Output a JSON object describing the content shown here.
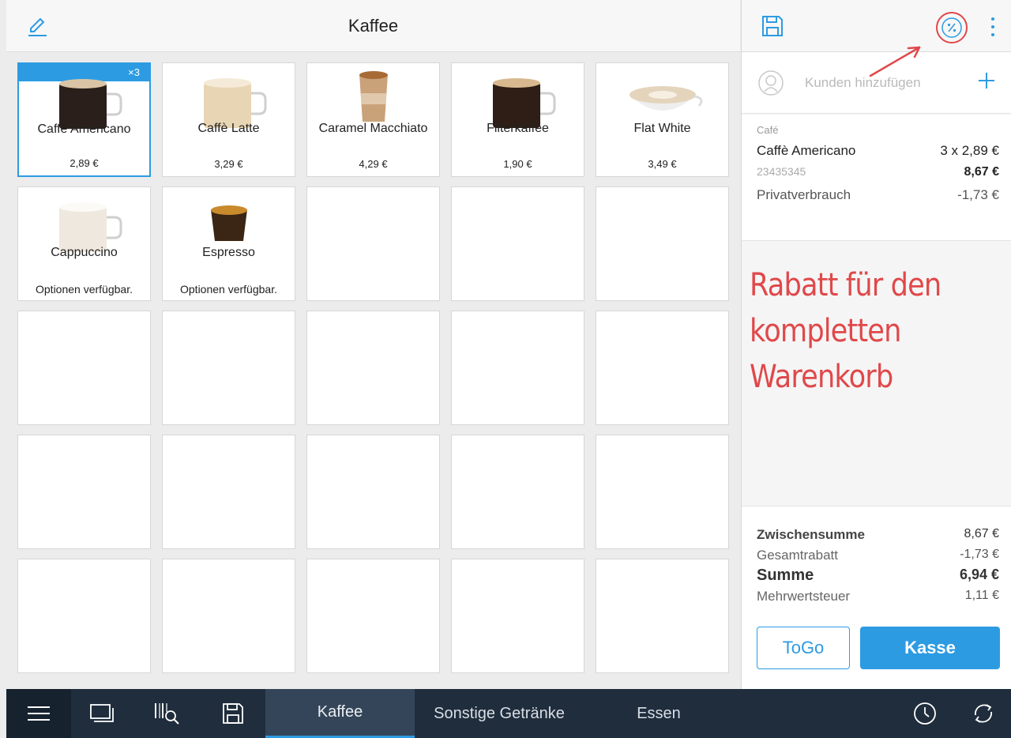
{
  "header": {
    "title": "Kaffee"
  },
  "products": [
    {
      "name": "Caffè Americano",
      "price": "2,89 €",
      "qty": "×3",
      "selected": true,
      "cup": "americano"
    },
    {
      "name": "Caffè Latte",
      "price": "3,29 €",
      "cup": "latte"
    },
    {
      "name": "Caramel Macchiato",
      "price": "4,29 €",
      "cup": "macchiato"
    },
    {
      "name": "Filterkaffee",
      "price": "1,90 €",
      "cup": "filter"
    },
    {
      "name": "Flat White",
      "price": "3,49 €",
      "cup": "flatwhite"
    },
    {
      "name": "Cappuccino",
      "options": "Optionen verfügbar.",
      "cup": "cappuccino"
    },
    {
      "name": "Espresso",
      "options": "Optionen verfügbar.",
      "cup": "espresso"
    }
  ],
  "customer": {
    "placeholder": "Kunden hinzufügen"
  },
  "cart": {
    "category": "Café",
    "item": {
      "name": "Caffè Americano",
      "qty_price": "3 x 2,89 €",
      "sku": "23435345",
      "total": "8,67 €"
    },
    "discount": {
      "label": "Privatverbrauch",
      "value": "-1,73 €"
    }
  },
  "annotation": {
    "lines": [
      "Rabatt für den",
      "kompletten",
      "Warenkorb"
    ]
  },
  "totals": {
    "subtotal_label": "Zwischensumme",
    "subtotal": "8,67 €",
    "discount_label": "Gesamtrabatt",
    "discount": "-1,73 €",
    "sum_label": "Summe",
    "sum": "6,94 €",
    "vat_label": "Mehrwertsteuer",
    "vat": "1,11 €"
  },
  "actions": {
    "togo": "ToGo",
    "checkout": "Kasse"
  },
  "nav": {
    "tabs": [
      "Kaffee",
      "Sonstige Getränke",
      "Essen"
    ],
    "active": "Kaffee"
  },
  "colors": {
    "accent": "#2d9be2",
    "nav_bg": "#1f2d3d",
    "annotation": "#e0484a"
  }
}
